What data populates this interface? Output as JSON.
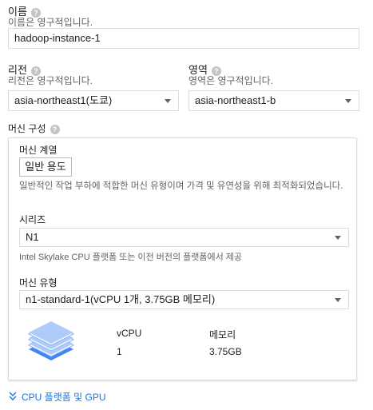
{
  "name": {
    "label": "이름",
    "hint": "이름은 영구적입니다.",
    "value": "hadoop-instance-1"
  },
  "region": {
    "label": "리전",
    "hint": "리전은 영구적입니다.",
    "value": "asia-northeast1(도쿄)"
  },
  "zone": {
    "label": "영역",
    "hint": "영역은 영구적입니다.",
    "value": "asia-northeast1-b"
  },
  "machine_config": {
    "label": "머신 구성",
    "family_label": "머신 계열",
    "family_chip": "일반 용도",
    "family_desc": "일반적인 작업 부하에 적합한 머신 유형이며 가격 및 유연성을 위해 최적화되었습니다.",
    "series_label": "시리즈",
    "series_value": "N1",
    "series_desc": "Intel Skylake CPU 플랫폼 또는 이전 버전의 플랫폼에서 제공",
    "type_label": "머신 유형",
    "type_value": "n1-standard-1(vCPU 1개, 3.75GB 메모리)",
    "specs": {
      "vcpu_header": "vCPU",
      "memory_header": "메모리",
      "vcpu_value": "1",
      "memory_value": "3.75GB"
    }
  },
  "cpu_platform_link": "CPU 플랫폼 및 GPU",
  "icons": {
    "help": "help-circle-icon",
    "caret": "dropdown-caret-icon",
    "stack": "layers-stack-icon",
    "expand": "double-chevron-down-icon"
  },
  "colors": {
    "accent": "#1a73e8",
    "stack_dark": "#4285f4",
    "stack_light": "#aecbfa"
  }
}
